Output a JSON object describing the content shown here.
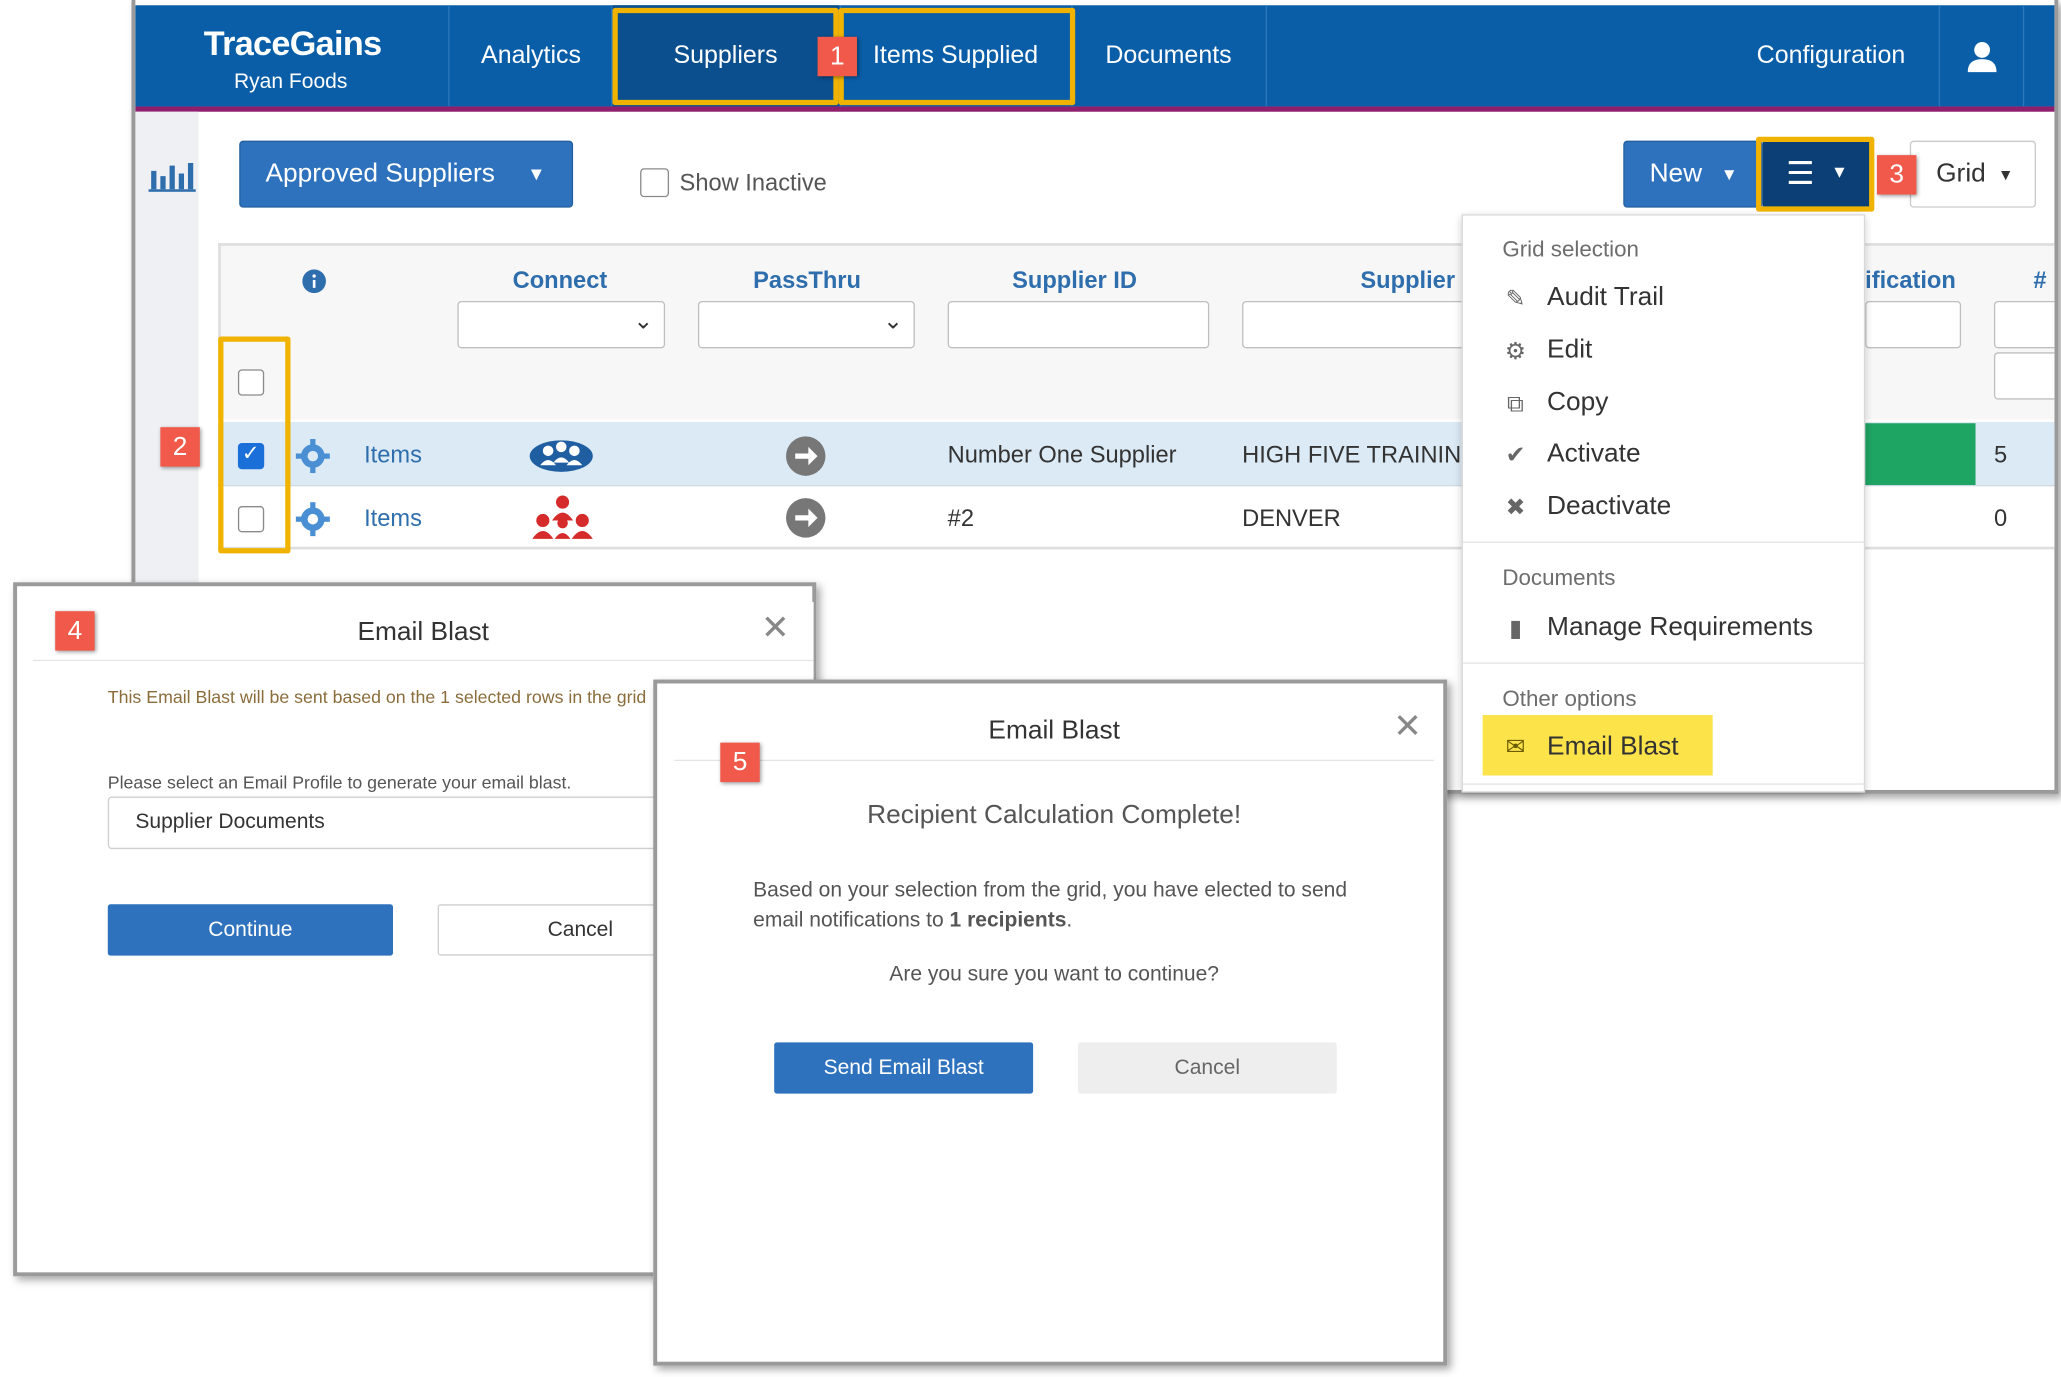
{
  "app": {
    "brand_name": "TraceGains",
    "company": "Ryan Foods"
  },
  "nav": {
    "analytics": "Analytics",
    "suppliers": "Suppliers",
    "items_supplied": "Items Supplied",
    "documents": "Documents",
    "configuration": "Configuration"
  },
  "toolbar": {
    "view_label": "Approved Suppliers",
    "show_inactive": "Show Inactive",
    "new_label": "New",
    "grid_label": "Grid"
  },
  "grid": {
    "columns": {
      "connect": "Connect",
      "passthru": "PassThru",
      "supplier_id": "Supplier ID",
      "supplier": "Supplier",
      "classification_partial": "ification",
      "count_partial": "#"
    },
    "rows": [
      {
        "link": "Items",
        "supplier_id": "Number One Supplier",
        "supplier": "HIGH FIVE TRAINING",
        "count": "5",
        "selected": true,
        "connect_color": "#2f6ead"
      },
      {
        "link": "Items",
        "supplier_id": "#2",
        "supplier": "DENVER",
        "count": "0",
        "selected": false,
        "connect_color": "#d62b2b"
      }
    ]
  },
  "menu": {
    "grid_selection_header": "Grid selection",
    "audit_trail": "Audit Trail",
    "edit": "Edit",
    "copy": "Copy",
    "activate": "Activate",
    "deactivate": "Deactivate",
    "documents_header": "Documents",
    "manage_requirements": "Manage Requirements",
    "other_options_header": "Other options",
    "email_blast": "Email Blast"
  },
  "badges": {
    "b1": "1",
    "b2": "2",
    "b3": "3",
    "b4": "4",
    "b5": "5"
  },
  "modal1": {
    "title": "Email Blast",
    "info": "This Email Blast will be sent based on the 1 selected rows in the grid",
    "profile_label": "Please select an Email Profile to generate your email blast.",
    "profile_value": "Supplier Documents",
    "continue": "Continue",
    "cancel": "Cancel"
  },
  "modal2": {
    "title": "Email Blast",
    "heading": "Recipient Calculation Complete!",
    "body_line1": "Based on your selection from the grid, you have elected to send",
    "body_line2_prefix": "email notifications to ",
    "body_line2_bold": "1 recipients",
    "body_line2_suffix": ".",
    "confirm": "Are you sure you want to continue?",
    "send": "Send Email Blast",
    "cancel": "Cancel"
  },
  "colors": {
    "nav_blue": "#0a5ea8",
    "highlight": "#f0b300",
    "badge_red": "#f15a4a",
    "button_blue": "#2e72be",
    "status_green": "#1ea463"
  }
}
